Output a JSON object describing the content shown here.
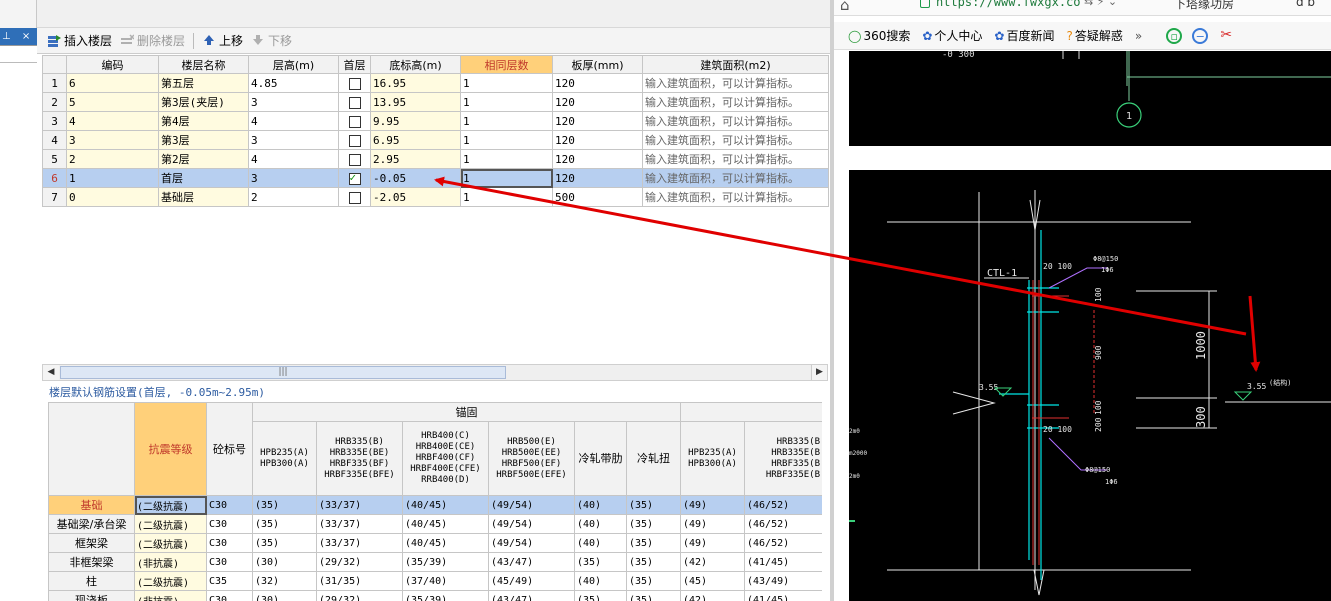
{
  "left_panel": {
    "pin_glyph": "⊥",
    "close_glyph": "×"
  },
  "toolbar": {
    "insert_label": "插入楼层",
    "delete_label": "删除楼层",
    "up_label": "上移",
    "down_label": "下移"
  },
  "floor_table": {
    "headers": [
      "编码",
      "楼层名称",
      "层高(m)",
      "首层",
      "底标高(m)",
      "相同层数",
      "板厚(mm)",
      "建筑面积(m2)"
    ],
    "rows": [
      {
        "n": "1",
        "code": "6",
        "name": "第五层",
        "height": "4.85",
        "first": false,
        "bottom": "16.95",
        "same": "1",
        "slab": "120",
        "area": "输入建筑面积，可以计算指标。"
      },
      {
        "n": "2",
        "code": "5",
        "name": "第3层(夹层)",
        "height": "3",
        "first": false,
        "bottom": "13.95",
        "same": "1",
        "slab": "120",
        "area": "输入建筑面积，可以计算指标。"
      },
      {
        "n": "3",
        "code": "4",
        "name": "第4层",
        "height": "4",
        "first": false,
        "bottom": "9.95",
        "same": "1",
        "slab": "120",
        "area": "输入建筑面积，可以计算指标。"
      },
      {
        "n": "4",
        "code": "3",
        "name": "第3层",
        "height": "3",
        "first": false,
        "bottom": "6.95",
        "same": "1",
        "slab": "120",
        "area": "输入建筑面积，可以计算指标。"
      },
      {
        "n": "5",
        "code": "2",
        "name": "第2层",
        "height": "4",
        "first": false,
        "bottom": "2.95",
        "same": "1",
        "slab": "120",
        "area": "输入建筑面积，可以计算指标。"
      },
      {
        "n": "6",
        "code": "1",
        "name": "首层",
        "height": "3",
        "first": true,
        "bottom": "-0.05",
        "same": "1",
        "slab": "120",
        "area": "输入建筑面积，可以计算指标。"
      },
      {
        "n": "7",
        "code": "0",
        "name": "基础层",
        "height": "2",
        "first": false,
        "bottom": "-2.05",
        "same": "1",
        "slab": "500",
        "area": "输入建筑面积，可以计算指标。"
      }
    ],
    "scroll_thumb_glyph": "|||"
  },
  "rebar_settings": {
    "title": "楼层默认钢筋设置(首层, -0.05m~2.95m)",
    "group_header": "锚固",
    "headers": {
      "seismic": "抗震等级",
      "concrete": "砼标号",
      "c1": [
        "HPB235(A)",
        "HPB300(A)"
      ],
      "c2": [
        "HRB335(B)",
        "HRB335E(BE)",
        "HRBF335(BF)",
        "HRBF335E(BFE)"
      ],
      "c3": [
        "HRB400(C)",
        "HRB400E(CE)",
        "HRBF400(CF)",
        "HRBF400E(CFE)",
        "RRB400(D)"
      ],
      "c4": [
        "HRB500(E)",
        "HRB500E(EE)",
        "HRBF500(EF)",
        "HRBF500E(EFE)"
      ],
      "c5": "冷轧带肋",
      "c6": "冷轧扭",
      "c7": [
        "HPB235(A)",
        "HPB300(A)"
      ],
      "c8": [
        "HRB335(B",
        "HRB335E(B",
        "HRBF335(B",
        "HRBF335E(B"
      ]
    },
    "rows": [
      {
        "name": "基础",
        "seismic": "(二级抗震)",
        "concrete": "C30",
        "v": [
          "(35)",
          "(33/37)",
          "(40/45)",
          "(49/54)",
          "(40)",
          "(35)",
          "(49)",
          "(46/52)"
        ]
      },
      {
        "name": "基础梁/承台梁",
        "seismic": "(二级抗震)",
        "concrete": "C30",
        "v": [
          "(35)",
          "(33/37)",
          "(40/45)",
          "(49/54)",
          "(40)",
          "(35)",
          "(49)",
          "(46/52)"
        ]
      },
      {
        "name": "框架梁",
        "seismic": "(二级抗震)",
        "concrete": "C30",
        "v": [
          "(35)",
          "(33/37)",
          "(40/45)",
          "(49/54)",
          "(40)",
          "(35)",
          "(49)",
          "(46/52)"
        ]
      },
      {
        "name": "非框架梁",
        "seismic": "(非抗震)",
        "concrete": "C30",
        "v": [
          "(30)",
          "(29/32)",
          "(35/39)",
          "(43/47)",
          "(35)",
          "(35)",
          "(42)",
          "(41/45)"
        ]
      },
      {
        "name": "柱",
        "seismic": "(二级抗震)",
        "concrete": "C35",
        "v": [
          "(32)",
          "(31/35)",
          "(37/40)",
          "(45/49)",
          "(40)",
          "(35)",
          "(45)",
          "(43/49)"
        ]
      },
      {
        "name": "现浇板",
        "seismic": "(非抗震)",
        "concrete": "C30",
        "v": [
          "(30)",
          "(29/32)",
          "(35/39)",
          "(43/47)",
          "(35)",
          "(35)",
          "(42)",
          "(41/45)"
        ]
      }
    ]
  },
  "browser": {
    "url": "https://www.fwxgx.co",
    "search_text": "下塔缘功房",
    "tail_text": "d b",
    "bookmarks": [
      "360搜索",
      "个人中心",
      "百度新闻",
      "答疑解惑"
    ],
    "more_glyph": "»"
  },
  "cad": {
    "top_dim": "-0 300",
    "axis_label": "1",
    "ctl_label": "CTL-1",
    "dims": [
      "20 100",
      "Φ8@150",
      "1Φ6",
      "100",
      "900",
      "100",
      "200",
      "20 100",
      "Φ8@150",
      "1Φ6"
    ],
    "elev_left": "3.55",
    "elev_right": "3.55",
    "elev_right_note": "(结构)",
    "big_dims": [
      "1000",
      "300"
    ],
    "left_marks": [
      "2m0",
      "m2000",
      "2m0"
    ]
  },
  "colors": {
    "selection": "#b7cff0",
    "header_highlight": "#ffd07a",
    "yellow_cell": "#fffbe0",
    "cad_background": "#000000",
    "cad_cyan": "#00e5e5",
    "cad_red": "#e03030",
    "annotation_arrow": "#e00000"
  }
}
